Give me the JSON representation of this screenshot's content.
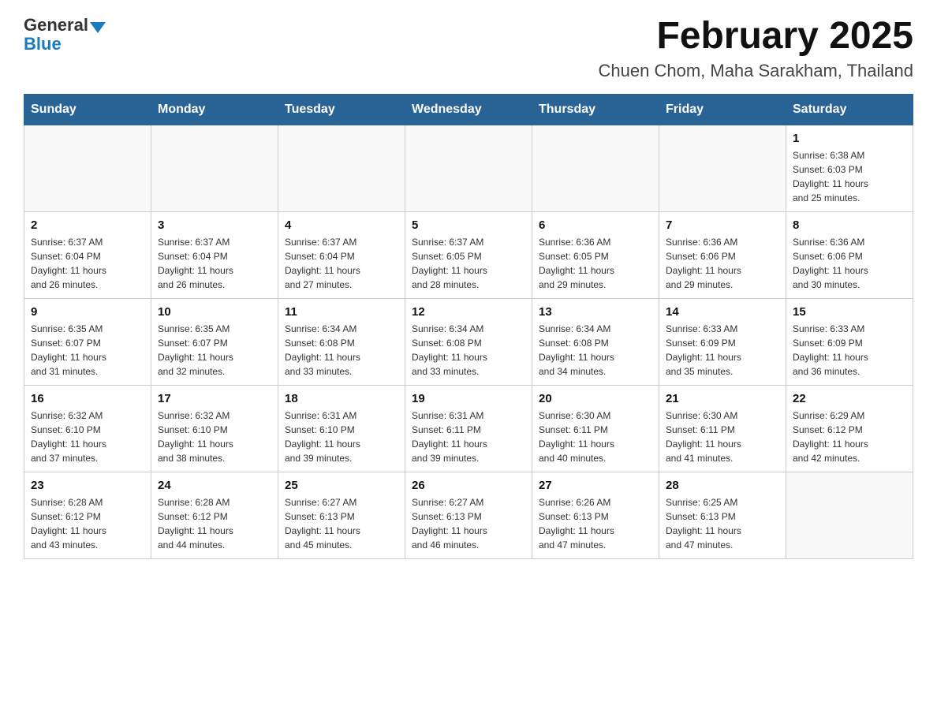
{
  "logo": {
    "general": "General",
    "blue": "Blue"
  },
  "title": "February 2025",
  "subtitle": "Chuen Chom, Maha Sarakham, Thailand",
  "headers": [
    "Sunday",
    "Monday",
    "Tuesday",
    "Wednesday",
    "Thursday",
    "Friday",
    "Saturday"
  ],
  "weeks": [
    [
      {
        "day": "",
        "info": ""
      },
      {
        "day": "",
        "info": ""
      },
      {
        "day": "",
        "info": ""
      },
      {
        "day": "",
        "info": ""
      },
      {
        "day": "",
        "info": ""
      },
      {
        "day": "",
        "info": ""
      },
      {
        "day": "1",
        "info": "Sunrise: 6:38 AM\nSunset: 6:03 PM\nDaylight: 11 hours\nand 25 minutes."
      }
    ],
    [
      {
        "day": "2",
        "info": "Sunrise: 6:37 AM\nSunset: 6:04 PM\nDaylight: 11 hours\nand 26 minutes."
      },
      {
        "day": "3",
        "info": "Sunrise: 6:37 AM\nSunset: 6:04 PM\nDaylight: 11 hours\nand 26 minutes."
      },
      {
        "day": "4",
        "info": "Sunrise: 6:37 AM\nSunset: 6:04 PM\nDaylight: 11 hours\nand 27 minutes."
      },
      {
        "day": "5",
        "info": "Sunrise: 6:37 AM\nSunset: 6:05 PM\nDaylight: 11 hours\nand 28 minutes."
      },
      {
        "day": "6",
        "info": "Sunrise: 6:36 AM\nSunset: 6:05 PM\nDaylight: 11 hours\nand 29 minutes."
      },
      {
        "day": "7",
        "info": "Sunrise: 6:36 AM\nSunset: 6:06 PM\nDaylight: 11 hours\nand 29 minutes."
      },
      {
        "day": "8",
        "info": "Sunrise: 6:36 AM\nSunset: 6:06 PM\nDaylight: 11 hours\nand 30 minutes."
      }
    ],
    [
      {
        "day": "9",
        "info": "Sunrise: 6:35 AM\nSunset: 6:07 PM\nDaylight: 11 hours\nand 31 minutes."
      },
      {
        "day": "10",
        "info": "Sunrise: 6:35 AM\nSunset: 6:07 PM\nDaylight: 11 hours\nand 32 minutes."
      },
      {
        "day": "11",
        "info": "Sunrise: 6:34 AM\nSunset: 6:08 PM\nDaylight: 11 hours\nand 33 minutes."
      },
      {
        "day": "12",
        "info": "Sunrise: 6:34 AM\nSunset: 6:08 PM\nDaylight: 11 hours\nand 33 minutes."
      },
      {
        "day": "13",
        "info": "Sunrise: 6:34 AM\nSunset: 6:08 PM\nDaylight: 11 hours\nand 34 minutes."
      },
      {
        "day": "14",
        "info": "Sunrise: 6:33 AM\nSunset: 6:09 PM\nDaylight: 11 hours\nand 35 minutes."
      },
      {
        "day": "15",
        "info": "Sunrise: 6:33 AM\nSunset: 6:09 PM\nDaylight: 11 hours\nand 36 minutes."
      }
    ],
    [
      {
        "day": "16",
        "info": "Sunrise: 6:32 AM\nSunset: 6:10 PM\nDaylight: 11 hours\nand 37 minutes."
      },
      {
        "day": "17",
        "info": "Sunrise: 6:32 AM\nSunset: 6:10 PM\nDaylight: 11 hours\nand 38 minutes."
      },
      {
        "day": "18",
        "info": "Sunrise: 6:31 AM\nSunset: 6:10 PM\nDaylight: 11 hours\nand 39 minutes."
      },
      {
        "day": "19",
        "info": "Sunrise: 6:31 AM\nSunset: 6:11 PM\nDaylight: 11 hours\nand 39 minutes."
      },
      {
        "day": "20",
        "info": "Sunrise: 6:30 AM\nSunset: 6:11 PM\nDaylight: 11 hours\nand 40 minutes."
      },
      {
        "day": "21",
        "info": "Sunrise: 6:30 AM\nSunset: 6:11 PM\nDaylight: 11 hours\nand 41 minutes."
      },
      {
        "day": "22",
        "info": "Sunrise: 6:29 AM\nSunset: 6:12 PM\nDaylight: 11 hours\nand 42 minutes."
      }
    ],
    [
      {
        "day": "23",
        "info": "Sunrise: 6:28 AM\nSunset: 6:12 PM\nDaylight: 11 hours\nand 43 minutes."
      },
      {
        "day": "24",
        "info": "Sunrise: 6:28 AM\nSunset: 6:12 PM\nDaylight: 11 hours\nand 44 minutes."
      },
      {
        "day": "25",
        "info": "Sunrise: 6:27 AM\nSunset: 6:13 PM\nDaylight: 11 hours\nand 45 minutes."
      },
      {
        "day": "26",
        "info": "Sunrise: 6:27 AM\nSunset: 6:13 PM\nDaylight: 11 hours\nand 46 minutes."
      },
      {
        "day": "27",
        "info": "Sunrise: 6:26 AM\nSunset: 6:13 PM\nDaylight: 11 hours\nand 47 minutes."
      },
      {
        "day": "28",
        "info": "Sunrise: 6:25 AM\nSunset: 6:13 PM\nDaylight: 11 hours\nand 47 minutes."
      },
      {
        "day": "",
        "info": ""
      }
    ]
  ]
}
